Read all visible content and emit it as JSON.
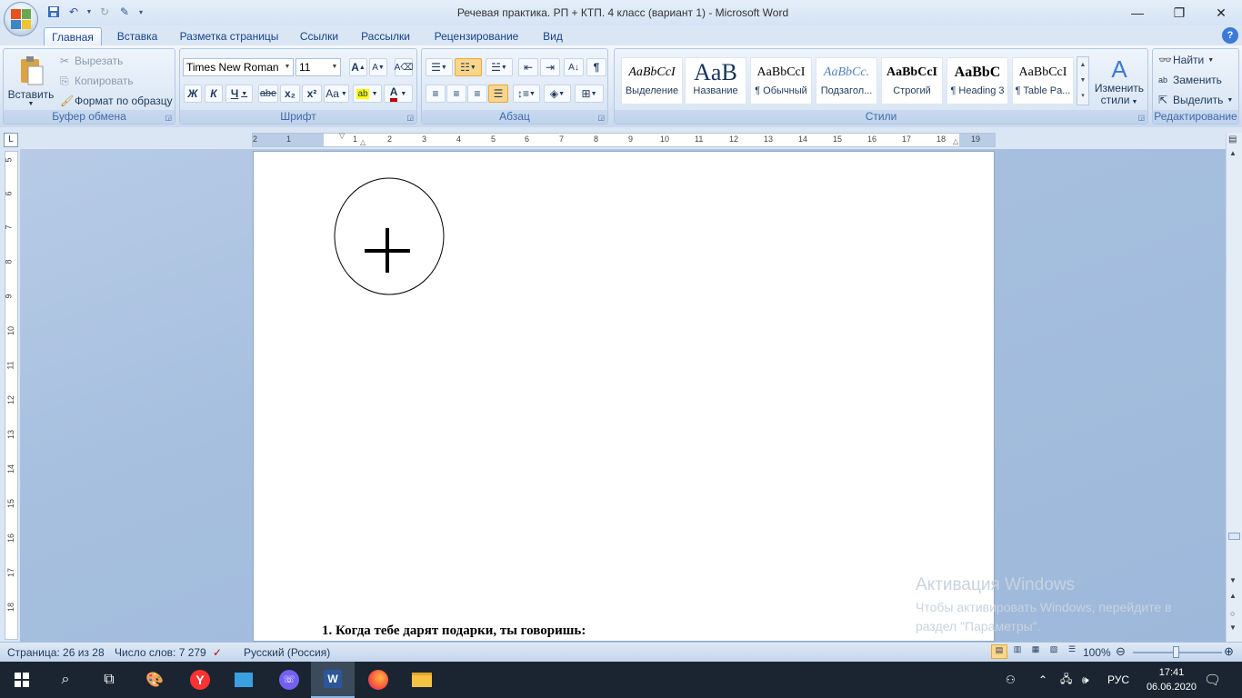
{
  "window": {
    "title": "Речевая практика. РП + КТП. 4 класс (вариант 1) - Microsoft Word",
    "minimize": "—",
    "maximize": "❐",
    "close": "✕"
  },
  "qat": {
    "save_icon": "save-icon",
    "undo_icon": "undo-icon",
    "redo_icon": "redo-icon",
    "customize_icon": "customize-icon"
  },
  "tabs": [
    "Главная",
    "Вставка",
    "Разметка страницы",
    "Ссылки",
    "Рассылки",
    "Рецензирование",
    "Вид"
  ],
  "active_tab": "Главная",
  "clipboard": {
    "paste": "Вставить",
    "cut": "Вырезать",
    "copy": "Копировать",
    "format_painter": "Формат по образцу",
    "label": "Буфер обмена"
  },
  "font": {
    "name": "Times New Roman",
    "size": "11",
    "bold": "Ж",
    "italic": "К",
    "underline": "Ч",
    "strike": "abe",
    "subscript": "x₂",
    "superscript": "x²",
    "change_case": "Aa",
    "highlight": "ab",
    "font_color": "A",
    "grow": "A",
    "shrink": "A",
    "label": "Шрифт"
  },
  "paragraph": {
    "label": "Абзац",
    "pilcrow": "¶"
  },
  "styles": {
    "items": [
      {
        "sample": "AaBbCcI",
        "name": "Выделение"
      },
      {
        "sample": "AaB",
        "name": "Название"
      },
      {
        "sample": "AaBbCcI",
        "name": "¶ Обычный"
      },
      {
        "sample": "AaBbCc.",
        "name": "Подзагол..."
      },
      {
        "sample": "AaBbCcI",
        "name": "Строгий"
      },
      {
        "sample": "AaBbC",
        "name": "¶ Heading 3"
      },
      {
        "sample": "AaBbCcI",
        "name": "¶ Table Pa..."
      }
    ],
    "change": "Изменить",
    "change2": "стили",
    "label": "Стили"
  },
  "editing": {
    "find": "Найти",
    "replace": "Заменить",
    "select": "Выделить",
    "label": "Редактирование"
  },
  "ruler_h": [
    "2",
    "1",
    "1",
    "2",
    "3",
    "4",
    "5",
    "6",
    "7",
    "8",
    "9",
    "10",
    "11",
    "12",
    "13",
    "14",
    "15",
    "16",
    "17",
    "18",
    "19"
  ],
  "ruler_v": [
    "5",
    "6",
    "7",
    "8",
    "9",
    "10",
    "11",
    "12",
    "13",
    "14",
    "15",
    "16",
    "17",
    "18"
  ],
  "document": {
    "question": "1. Когда тебе дарят подарки, ты говоришь:"
  },
  "activation": {
    "title": "Активация Windows",
    "line1": "Чтобы активировать Windows, перейдите в",
    "line2": "раздел \"Параметры\"."
  },
  "status": {
    "page": "Страница: 26 из 28",
    "words": "Число слов: 7 279",
    "language": "Русский (Россия)",
    "zoom": "100%"
  },
  "taskbar": {
    "lang": "РУС",
    "time": "17:41",
    "date": "06.06.2020"
  }
}
